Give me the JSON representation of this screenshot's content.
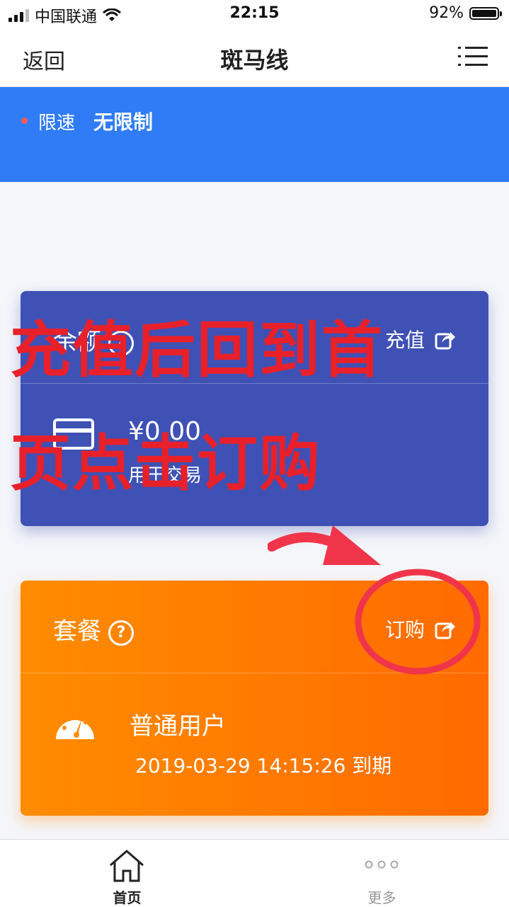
{
  "status_bar": {
    "carrier": "中国联通",
    "time": "22:15",
    "battery": "92%"
  },
  "nav": {
    "back_label": "返回",
    "title": "斑马线",
    "menu_icon": "menu-icon"
  },
  "banner": {
    "speed_label": "限速",
    "speed_value": "无限制"
  },
  "balance_card": {
    "title": "余额",
    "action_label": "充值",
    "amount": "¥0.00",
    "subtitle": "用于交易"
  },
  "plan_card": {
    "title": "套餐",
    "help_glyph": "?",
    "action_label": "订购",
    "plan_type": "普通用户",
    "expiry": "2019-03-29 14:15:26 到期"
  },
  "annotation": {
    "line1": "充值后回到首",
    "line2": "页点击订购",
    "color": "#e8202a"
  },
  "tab_bar": {
    "home_label": "首页",
    "more_label": "更多"
  },
  "colors": {
    "banner": "#2f7cf6",
    "balance_card": "#3f51b5",
    "plan_card": "#ff8c00"
  }
}
